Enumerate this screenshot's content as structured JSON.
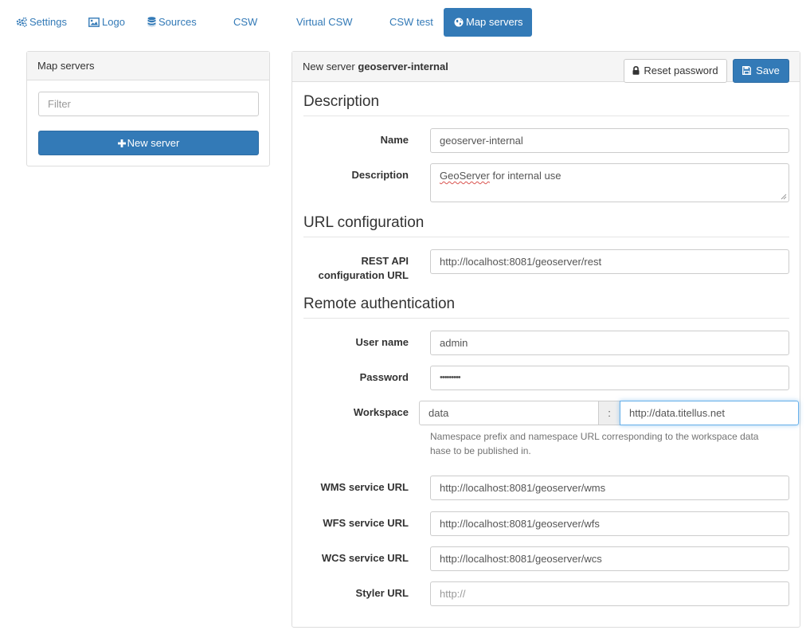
{
  "nav": {
    "items": [
      {
        "label": "Settings",
        "icon": "gears-icon"
      },
      {
        "label": "Logo",
        "icon": "image-icon"
      },
      {
        "label": "Sources",
        "icon": "database-icon"
      },
      {
        "label": "CSW"
      },
      {
        "label": "Virtual CSW"
      },
      {
        "label": "CSW test"
      },
      {
        "label": "Map servers",
        "icon": "globe-icon",
        "active": true
      }
    ]
  },
  "sidebar": {
    "title": "Map servers",
    "filter_placeholder": "Filter",
    "new_server_button": "New server"
  },
  "editor": {
    "header_prefix": "New server",
    "header_name": "geoserver-internal",
    "reset_password_button": "Reset password",
    "save_button": "Save",
    "sections": {
      "description": "Description",
      "url_configuration": "URL configuration",
      "remote_authentication": "Remote authentication"
    },
    "fields": {
      "name": {
        "label": "Name",
        "value": "geoserver-internal"
      },
      "description": {
        "label": "Description",
        "value_word1": "GeoServer",
        "value_rest": " for internal use"
      },
      "rest_api": {
        "label_line1": "REST API",
        "label_line2": "configuration URL",
        "value": "http://localhost:8081/geoserver/rest"
      },
      "username": {
        "label": "User name",
        "value": "admin"
      },
      "password": {
        "label": "Password",
        "value": "•••••••••"
      },
      "workspace": {
        "label": "Workspace",
        "prefix": "data",
        "separator": ":",
        "url": "http://data.titellus.net",
        "help_line1": "Namespace prefix and namespace URL corresponding to the workspace data",
        "help_line2": "hase to be published in."
      },
      "wms": {
        "label": "WMS service URL",
        "value": "http://localhost:8081/geoserver/wms"
      },
      "wfs": {
        "label": "WFS service URL",
        "value": "http://localhost:8081/geoserver/wfs"
      },
      "wcs": {
        "label": "WCS service URL",
        "value": "http://localhost:8081/geoserver/wcs"
      },
      "styler": {
        "label": "Styler URL",
        "placeholder": "http://"
      }
    }
  },
  "colors": {
    "primary": "#337ab7",
    "panel_heading": "#f5f5f5",
    "border": "#dddddd",
    "focus": "#66afe9"
  }
}
